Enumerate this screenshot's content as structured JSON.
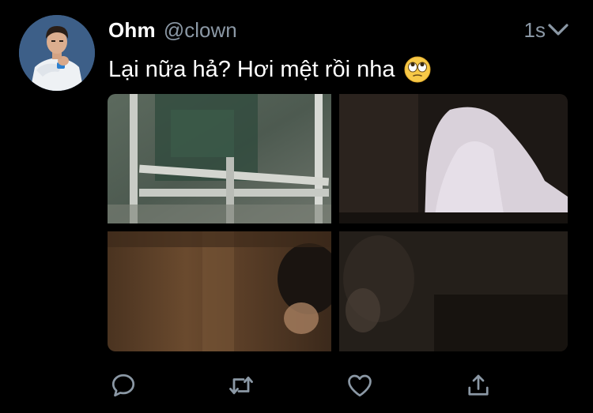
{
  "tweet": {
    "author": {
      "display_name": "Ohm",
      "handle": "@clown"
    },
    "timestamp": "1s",
    "text": "Lại nữa hả? Hơi mệt rồi nha",
    "emoji": "face-with-rolling-eyes"
  },
  "media": {
    "count": 4,
    "images": [
      {
        "name": "photo-1"
      },
      {
        "name": "photo-2"
      },
      {
        "name": "photo-3"
      },
      {
        "name": "photo-4"
      }
    ]
  },
  "actions": [
    {
      "name": "reply",
      "icon": "reply-icon"
    },
    {
      "name": "retweet",
      "icon": "retweet-icon"
    },
    {
      "name": "like",
      "icon": "heart-icon"
    },
    {
      "name": "share",
      "icon": "share-icon"
    }
  ],
  "colors": {
    "background": "#000000",
    "text_primary": "#ffffff",
    "text_secondary": "#8b98a5",
    "icon": "#8b98a5"
  }
}
